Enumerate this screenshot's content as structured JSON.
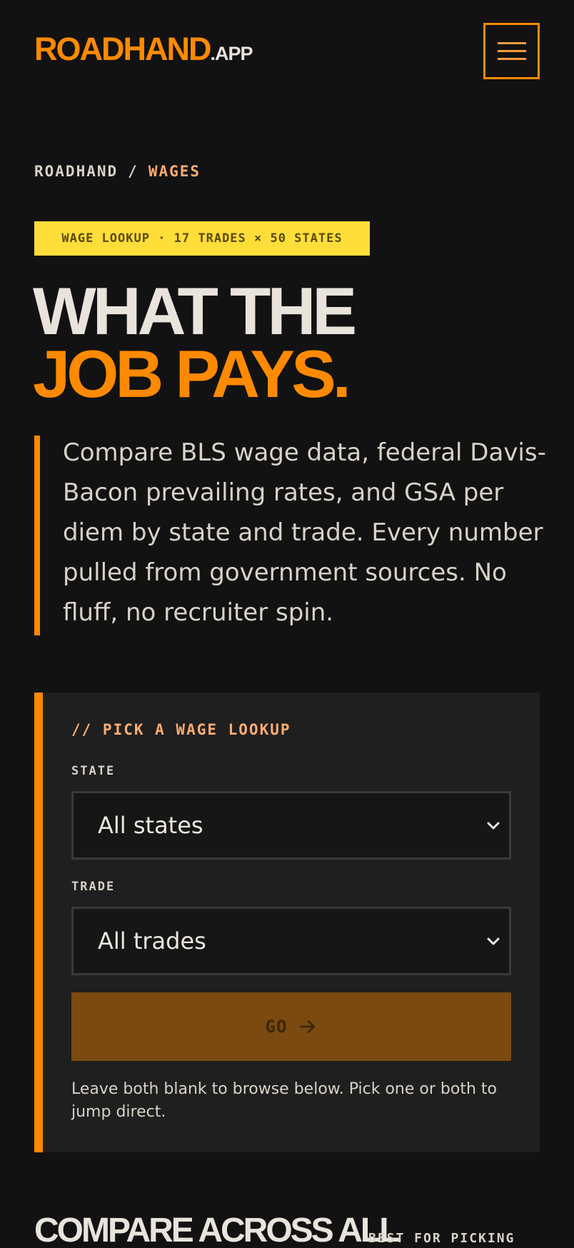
{
  "header": {
    "logo_main": "ROADHAND",
    "logo_tld": ".APP",
    "menu_icon": "hamburger-menu-icon"
  },
  "breadcrumb": {
    "root": "ROADHAND",
    "separator": "/",
    "current": "WAGES"
  },
  "badge": "WAGE LOOKUP · 17 TRADES × 50 STATES",
  "headline": {
    "line1": "WHAT THE",
    "line2": "JOB PAYS."
  },
  "intro": "Compare BLS wage data, federal Davis-Bacon prevailing rates, and GSA per diem by state and trade. Every number pulled from government sources. No fluff, no recruiter spin.",
  "lookup": {
    "title": "// PICK A WAGE LOOKUP",
    "state_label": "STATE",
    "state_value": "All states",
    "trade_label": "TRADE",
    "trade_value": "All trades",
    "go_label": "GO",
    "go_icon": "arrow-right-icon",
    "select_icon": "chevron-down-icon",
    "hint": "Leave both blank to browse below. Pick one or both to jump direct."
  },
  "compare": {
    "title": "COMPARE ACROSS ALL",
    "note": "BEST FOR PICKING"
  },
  "colors": {
    "background": "#121212",
    "accent": "#ff8a00",
    "accent_light": "#ffad70",
    "badge_bg": "#ffde3a",
    "card_bg": "#1f1f1f",
    "button_bg": "#7a4a10",
    "text": "#e8e4dc"
  }
}
